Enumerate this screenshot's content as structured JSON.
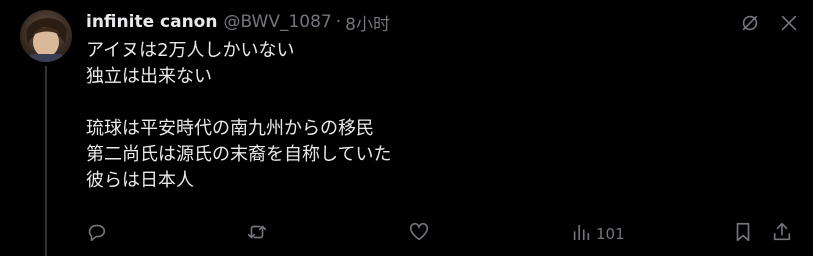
{
  "tweet": {
    "author_name": "infinite canon",
    "handle": "@BWV_1087",
    "separator": "·",
    "time": "8小时",
    "lines": [
      "アイヌは2万人しかいない",
      "独立は出来ない",
      "",
      "琉球は平安時代の南九州からの移民",
      "第二尚氏は源氏の末裔を自称していた",
      "彼らは日本人"
    ]
  },
  "actions": {
    "views_count": "101"
  },
  "icons": {
    "top_right": [
      "grok-icon",
      "close-icon"
    ],
    "actions": [
      "reply-icon",
      "retweet-icon",
      "like-icon",
      "views-icon",
      "bookmark-icon",
      "share-icon"
    ]
  }
}
